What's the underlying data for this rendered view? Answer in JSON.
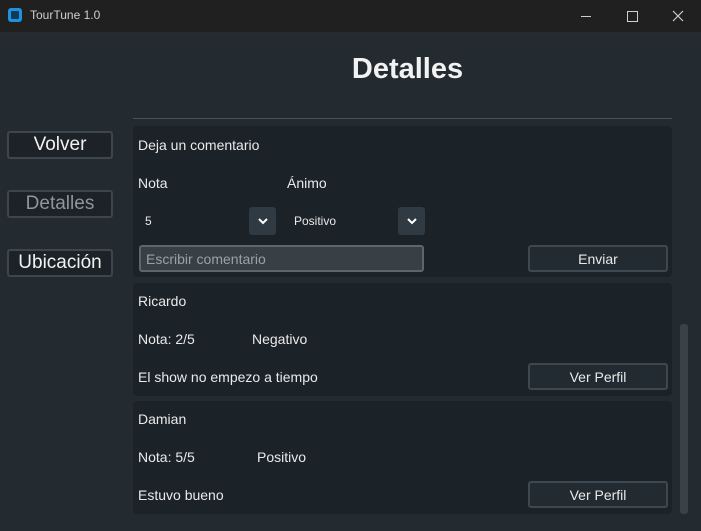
{
  "window": {
    "title": "TourTune 1.0"
  },
  "page": {
    "title": "Detalles"
  },
  "nav": {
    "volver": "Volver",
    "detalles": "Detalles",
    "ubicacion": "Ubicación"
  },
  "comment_form": {
    "heading": "Deja un comentario",
    "nota_label": "Nota",
    "animo_label": "Ánimo",
    "nota_value": "5",
    "animo_value": "Positivo",
    "placeholder": "Escribir comentario",
    "submit_label": "Enviar"
  },
  "comments": [
    {
      "user": "Ricardo",
      "nota": "Nota: 2/5",
      "animo": "Negativo",
      "text": "El show no empezo a tiempo",
      "button": "Ver Perfil"
    },
    {
      "user": "Damian",
      "nota": "Nota: 5/5",
      "animo": "Positivo",
      "text": "Estuvo bueno",
      "button": "Ver Perfil"
    }
  ],
  "colors": {
    "accent": "#1d93e0",
    "background": "#232b31",
    "card": "#1b2228"
  }
}
